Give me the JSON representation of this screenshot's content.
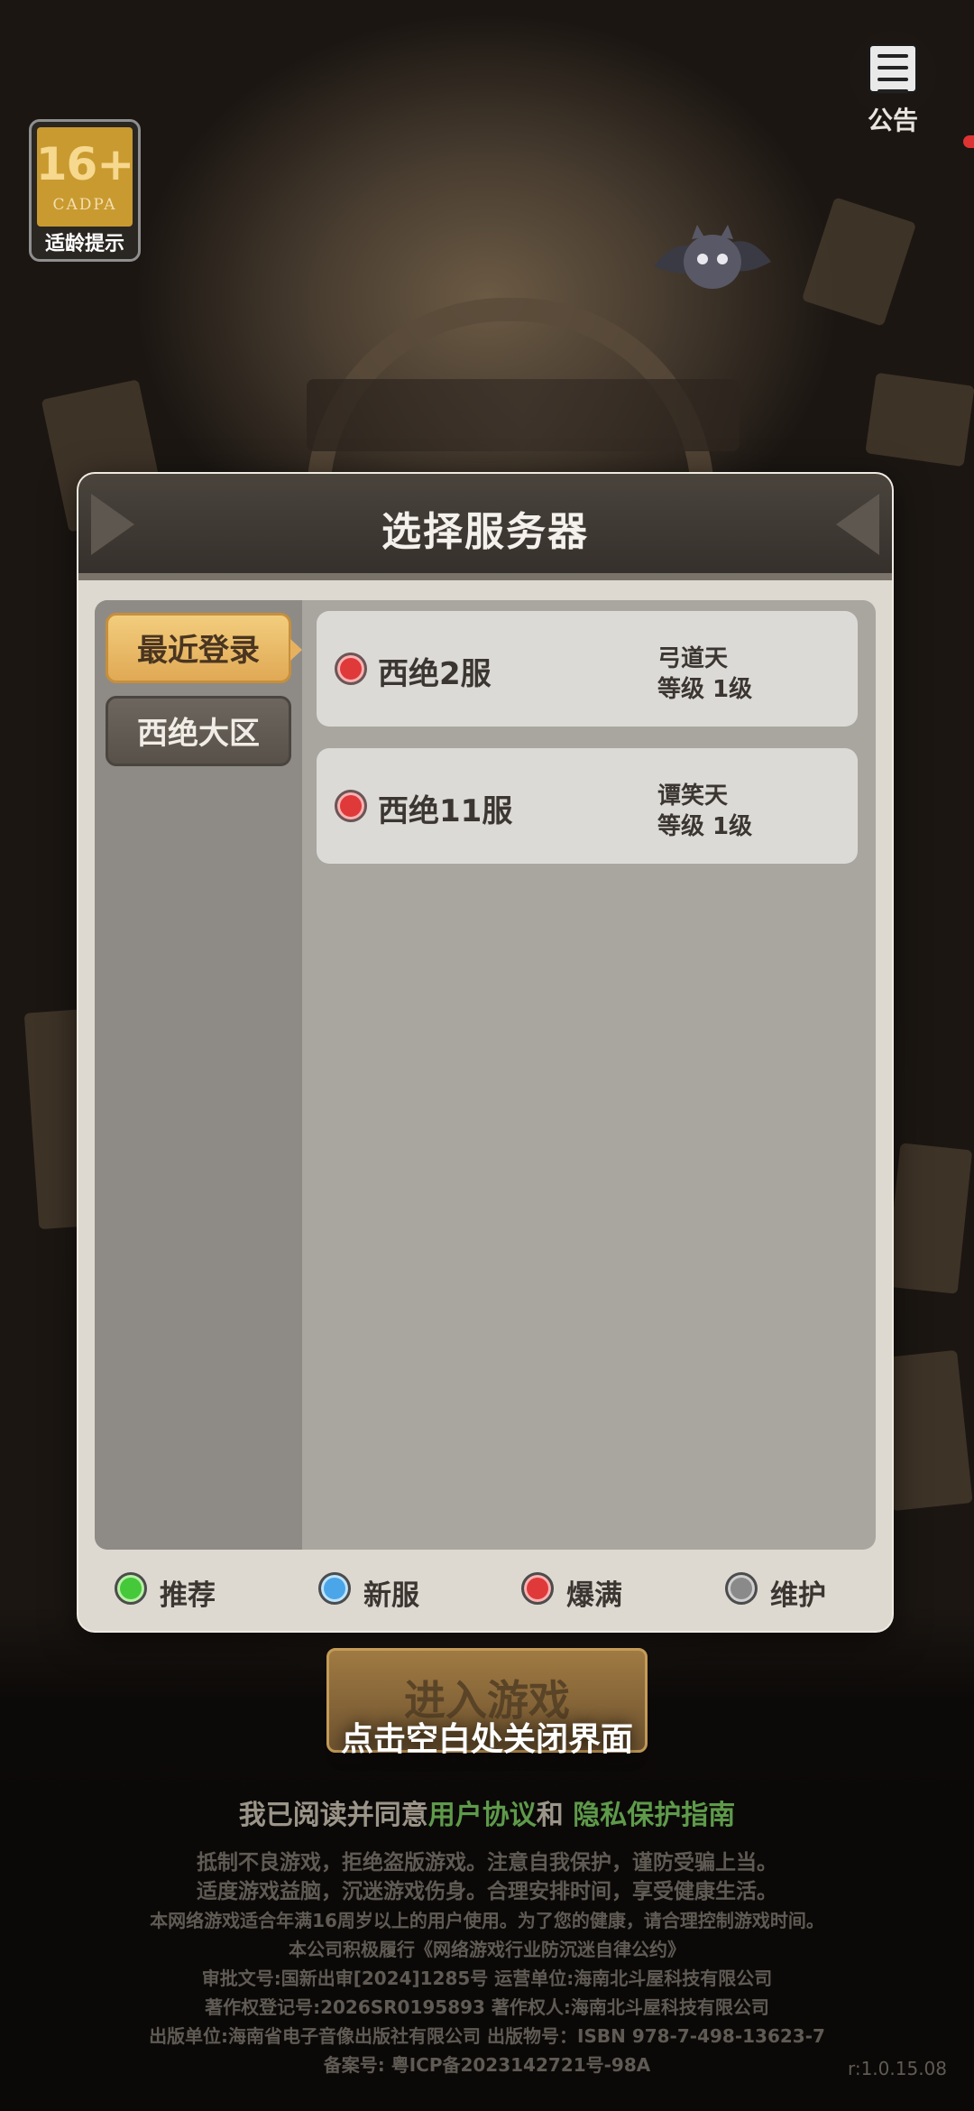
{
  "age_badge": {
    "age": "16+",
    "org": "CADPA",
    "tip": "适龄提示"
  },
  "notice": {
    "label": "公告"
  },
  "panel": {
    "title": "选择服务器",
    "tabs": [
      {
        "label": "最近登录",
        "active": true
      },
      {
        "label": "西绝大区",
        "active": false
      }
    ],
    "servers": [
      {
        "name": "西绝2服",
        "player": "弓道天",
        "level": "等级 1级",
        "status": "爆满"
      },
      {
        "name": "西绝11服",
        "player": "谭笑天",
        "level": "等级 1级",
        "status": "爆满"
      }
    ],
    "legend": [
      {
        "label": "推荐",
        "color": "#45c83a"
      },
      {
        "label": "新服",
        "color": "#4aa6e8"
      },
      {
        "label": "爆满",
        "color": "#e0393a"
      },
      {
        "label": "维护",
        "color": "#8a8a8a"
      }
    ]
  },
  "enter_button": "进入游戏",
  "close_hint": "点击空白处关闭界面",
  "agreement": {
    "prefix": "我已阅读并同意",
    "user_agreement": "用户协议",
    "and": "和",
    "privacy": "隐私保护指南"
  },
  "footer": {
    "lines": [
      "抵制不良游戏，拒绝盗版游戏。注意自我保护，谨防受骗上当。",
      "适度游戏益脑，沉迷游戏伤身。合理安排时间，享受健康生活。",
      "本网络游戏适合年满16周岁以上的用户使用。为了您的健康，请合理控制游戏时间。",
      "本公司积极履行《网络游戏行业防沉迷自律公约》",
      "审批文号:国新出审[2024]1285号 运营单位:海南北斗屋科技有限公司",
      "著作权登记号:2026SR0195893 著作权人:海南北斗屋科技有限公司",
      "出版单位:海南省电子音像出版社有限公司 出版物号：ISBN 978-7-498-13623-7",
      "备案号: 粤ICP备2023142721号-98A"
    ],
    "version": "r:1.0.15.08"
  }
}
